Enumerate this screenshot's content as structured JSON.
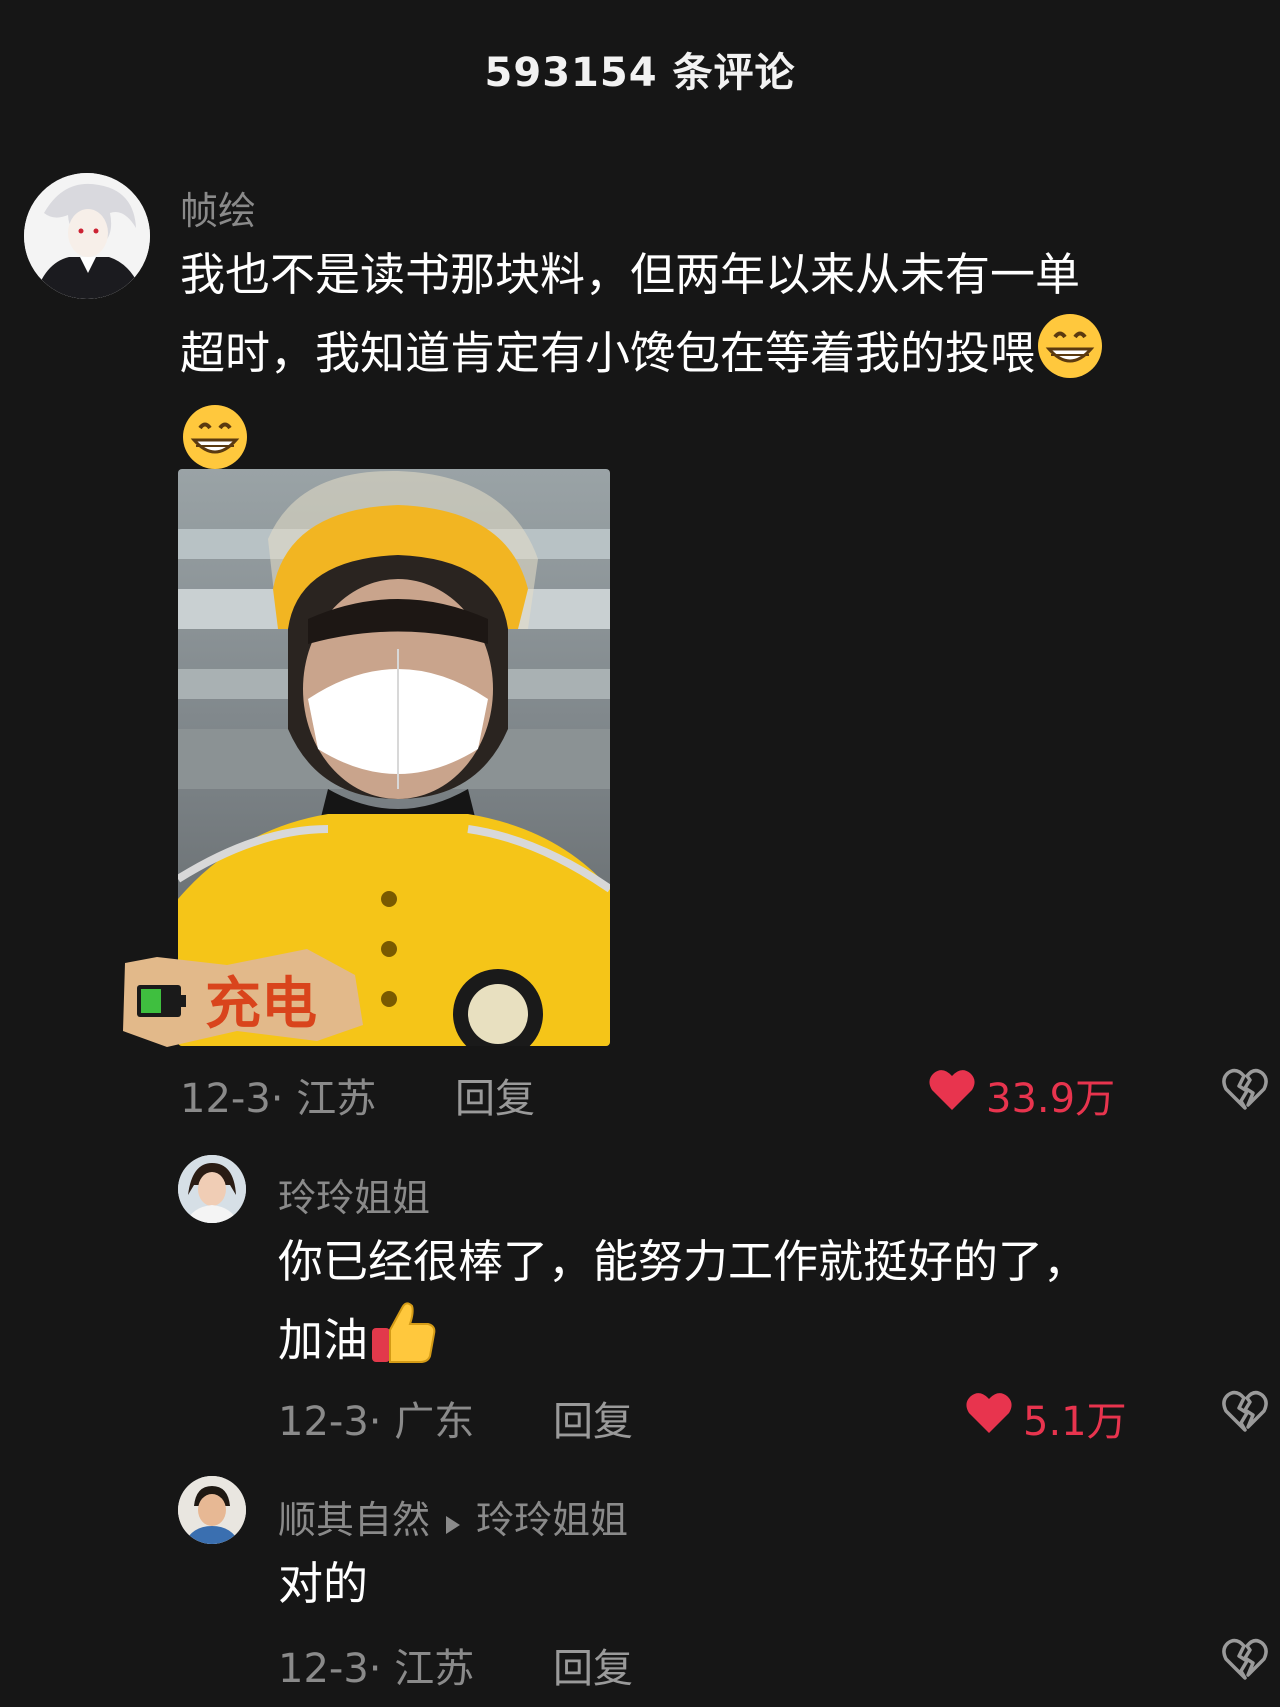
{
  "header": {
    "title": "593154 条评论"
  },
  "comments": [
    {
      "user": "帧绘",
      "text_line1": "我也不是读书那块料，但两年以来从未有一单",
      "text_line2": "超时，我知道肯定有小馋包在等着我的投喂",
      "emojis": [
        "grin-emoji",
        "grin-emoji"
      ],
      "image": "delivery-rider-selfie",
      "sticker_text": "充电",
      "date_location": "12-3· 江苏",
      "reply_label": "回复",
      "likes": "33.9万"
    },
    {
      "user": "玲玲姐姐",
      "text_line1": "你已经很棒了，能努力工作就挺好的了，",
      "text_line2": "加油",
      "emojis": [
        "thumbs-up-emoji"
      ],
      "date_location": "12-3· 广东",
      "reply_label": "回复",
      "likes": "5.1万"
    },
    {
      "user": "顺其自然",
      "reply_to": "玲玲姐姐",
      "text_line1": "对的",
      "date_location": "12-3· 江苏",
      "reply_label": "回复"
    }
  ],
  "colors": {
    "background": "#161616",
    "like": "#e8344e",
    "muted": "#8a8a8a"
  }
}
